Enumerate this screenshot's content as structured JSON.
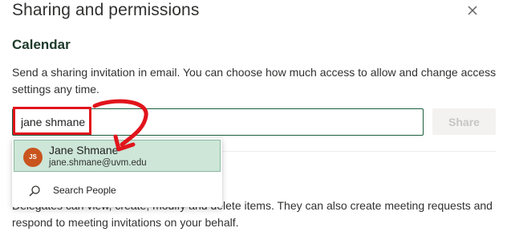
{
  "dialog": {
    "title": "Sharing and permissions",
    "close_icon": "close-icon"
  },
  "calendar": {
    "heading": "Calendar",
    "description": "Send a sharing invitation in email. You can choose how much access to allow and change access settings any time.",
    "search_value": "jane shmane",
    "share_label": "Share"
  },
  "suggestions": [
    {
      "initials": "JS",
      "name": "Jane Shmane",
      "email": "jane.shmane@uvm.edu",
      "avatar_color": "#c9541e"
    }
  ],
  "search_people": {
    "label": "Search People",
    "icon": "search-icon"
  },
  "delegates": {
    "description": "Delegates can view, create, modify and delete items. They can also create meeting requests and respond to meeting invitations on your behalf."
  },
  "annotation": {
    "highlight_color": "#e1141c"
  }
}
